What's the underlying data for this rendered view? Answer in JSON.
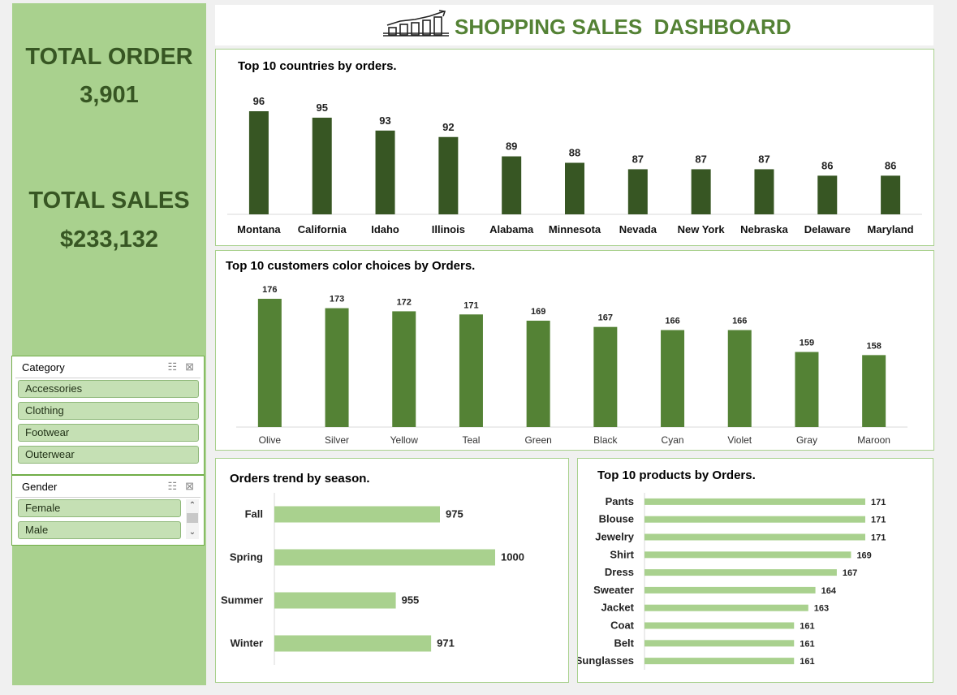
{
  "kpis": {
    "total_order_label": "TOTAL ORDER",
    "total_order_value": "3,901",
    "total_sales_label": "TOTAL SALES",
    "total_sales_value": "$233,132"
  },
  "dashboard_title": "SHOPPING SALES  DASHBOARD",
  "slicers": {
    "category": {
      "title": "Category",
      "items": [
        "Accessories",
        "Clothing",
        "Footwear",
        "Outerwear"
      ]
    },
    "gender": {
      "title": "Gender",
      "items": [
        "Female",
        "Male"
      ]
    }
  },
  "colors": {
    "dark_green": "#375623",
    "mid_green": "#548235",
    "light_green": "#a9d18e"
  },
  "chart_data": [
    {
      "type": "bar",
      "title": "Top 10 countries by orders.",
      "categories": [
        "Montana",
        "California",
        "Idaho",
        "Illinois",
        "Alabama",
        "Minnesota",
        "Nevada",
        "New York",
        "Nebraska",
        "Delaware",
        "Maryland"
      ],
      "values": [
        96,
        95,
        93,
        92,
        89,
        88,
        87,
        87,
        87,
        86,
        86
      ],
      "color": "#375623"
    },
    {
      "type": "bar",
      "title": "Top 10 customers color choices by Orders.",
      "categories": [
        "Olive",
        "Silver",
        "Yellow",
        "Teal",
        "Green",
        "Black",
        "Cyan",
        "Violet",
        "Gray",
        "Maroon"
      ],
      "values": [
        176,
        173,
        172,
        171,
        169,
        167,
        166,
        166,
        159,
        158
      ],
      "color": "#548235"
    },
    {
      "type": "bar",
      "orientation": "horizontal",
      "title": "Orders trend by season.",
      "categories": [
        "Fall",
        "Spring",
        "Summer",
        "Winter"
      ],
      "values": [
        975,
        1000,
        955,
        971
      ],
      "color": "#a9d18e"
    },
    {
      "type": "bar",
      "orientation": "horizontal",
      "title": "Top 10 products by Orders.",
      "categories": [
        "Pants",
        "Blouse",
        "Jewelry",
        "Shirt",
        "Dress",
        "Sweater",
        "Jacket",
        "Coat",
        "Belt",
        "Sunglasses"
      ],
      "values": [
        171,
        171,
        171,
        169,
        167,
        164,
        163,
        161,
        161,
        161
      ],
      "color": "#a9d18e"
    }
  ]
}
